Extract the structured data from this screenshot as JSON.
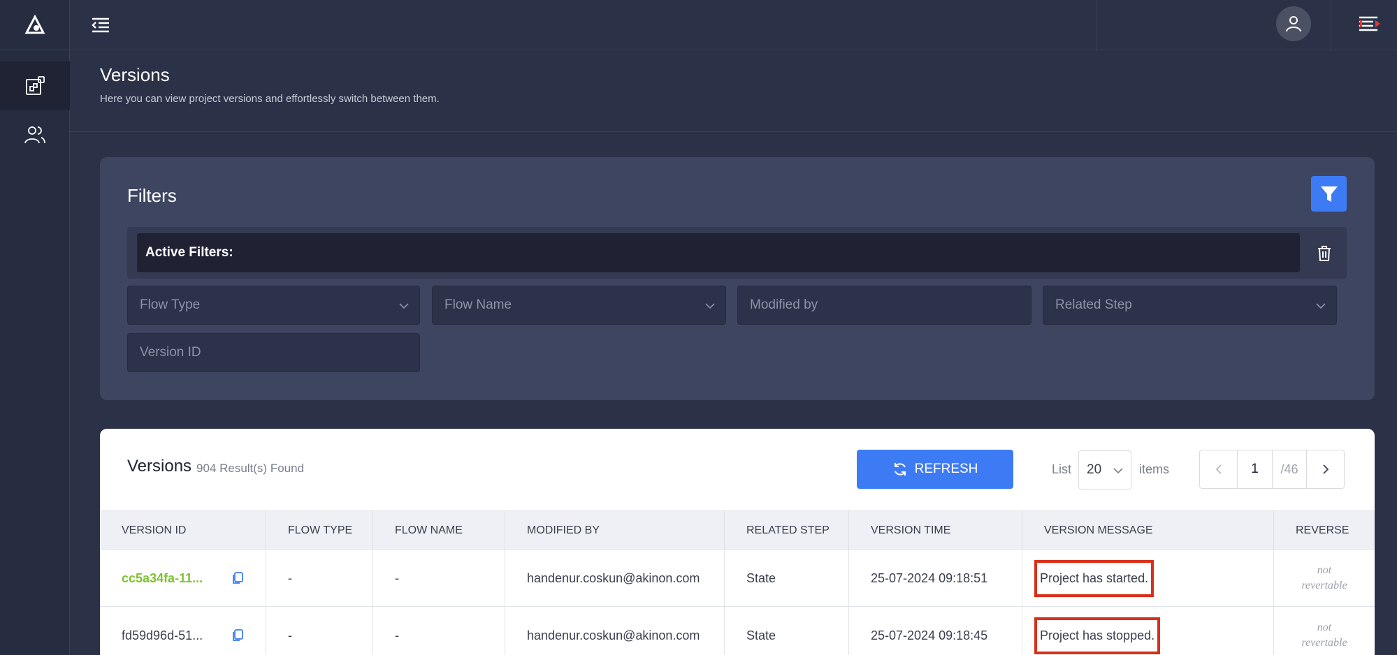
{
  "page": {
    "title": "Versions",
    "subtitle": "Here you can view project versions and effortlessly switch between them."
  },
  "sidebar": {
    "items": [
      {
        "icon": "dashboard-icon",
        "active": true
      },
      {
        "icon": "users-icon",
        "active": false
      }
    ]
  },
  "topbar": {
    "collapse_icon": "collapse-menu-icon",
    "user_icon": "user-icon",
    "menu_icon": "side-panel-icon"
  },
  "filters": {
    "title": "Filters",
    "active_label": "Active Filters:",
    "fields": {
      "flow_type": "Flow Type",
      "flow_name": "Flow Name",
      "modified_by": "Modified by",
      "related_step": "Related Step",
      "version_id": "Version ID"
    }
  },
  "versions": {
    "title": "Versions",
    "count": "904 Result(s) Found",
    "refresh_label": "REFRESH",
    "list_label": "List",
    "list_value": "20",
    "items_label": "items",
    "page_current": "1",
    "page_total": "/46",
    "columns": [
      "VERSION ID",
      "FLOW TYPE",
      "FLOW NAME",
      "MODIFIED BY",
      "RELATED STEP",
      "VERSION TIME",
      "VERSION MESSAGE",
      "REVERSE"
    ],
    "rows": [
      {
        "version_id": "cc5a34fa-11...",
        "flow_type": "-",
        "flow_name": "-",
        "modified_by": "handenur.coskun@akinon.com",
        "related_step": "State",
        "version_time": "25-07-2024 09:18:51",
        "version_message": "Project has started.",
        "reverse_line1": "not",
        "reverse_line2": "revertable"
      },
      {
        "version_id": "fd59d96d-51...",
        "flow_type": "-",
        "flow_name": "-",
        "modified_by": "handenur.coskun@akinon.com",
        "related_step": "State",
        "version_time": "25-07-2024 09:18:45",
        "version_message": "Project has stopped.",
        "reverse_line1": "not",
        "reverse_line2": "revertable"
      }
    ]
  },
  "colors": {
    "accent": "#3d7bf5",
    "highlight": "#d8301c",
    "version_id_green": "#7cc22f"
  }
}
